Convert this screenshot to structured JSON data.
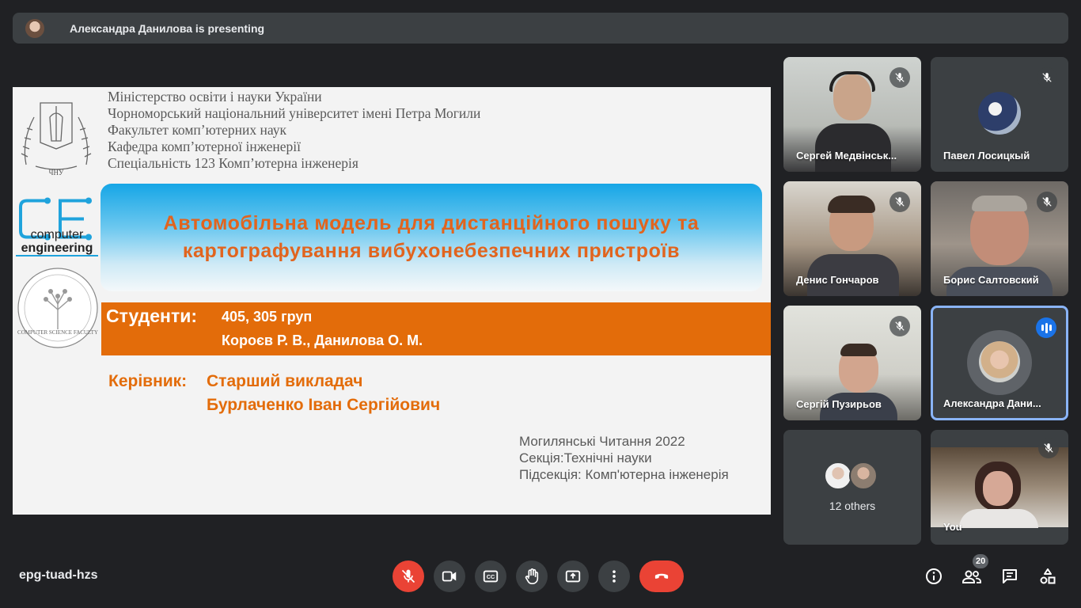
{
  "presenter_bar": {
    "text": "Александра Данилова is presenting"
  },
  "slide": {
    "ministry_lines": [
      "Міністерство освіти і науки України",
      "Чорноморський національний університет імені Петра Могили",
      "Факультет комп’ютерних наук",
      "Кафедра комп’ютерної інженерії",
      "Спеціальність 123 Комп’ютерна інженерія"
    ],
    "chnu_label": "ЧНУ",
    "ce_logo_line1": "computer",
    "ce_logo_line2": "engineering",
    "csf_label": "COMPUTER SCIENCE FACULTY",
    "title_line1": "Автомобільна модель для дистанційного пошуку та",
    "title_line2": "картографування вибухонебезпечних пристроїв",
    "students_label": "Студенти:",
    "students_groups": "405, 305 груп",
    "students_names": "Короєв Р. В., Данилова О. М.",
    "supervisor_label": "Керівник:",
    "supervisor_line1": "Старший викладач",
    "supervisor_line2": "Бурлаченко Іван Сергійович",
    "event_line1": "Могилянські Читання 2022",
    "event_line2": "Секція:Технічні науки",
    "event_line3": "Підсекція: Комп'ютерна інженерія"
  },
  "participants": [
    {
      "name": "Сергей Медвінськ...",
      "muted": true
    },
    {
      "name": "Павел Лосицкый",
      "muted": true
    },
    {
      "name": "Денис Гончаров",
      "muted": true
    },
    {
      "name": "Борис Салтовский",
      "muted": true
    },
    {
      "name": "Сергій Пузирьов",
      "muted": true
    },
    {
      "name": "Александра Дани...",
      "muted": false,
      "speaking": true
    },
    {
      "name": "12 others"
    },
    {
      "name": "You",
      "muted": true
    }
  ],
  "footer": {
    "meeting_code": "epg-tuad-hzs",
    "participant_count": "20"
  },
  "colors": {
    "background": "#202124",
    "tile": "#3c4043",
    "hangup": "#ea4335",
    "accent_orange": "#e36c0a",
    "speaking_blue": "#1a73e8"
  }
}
